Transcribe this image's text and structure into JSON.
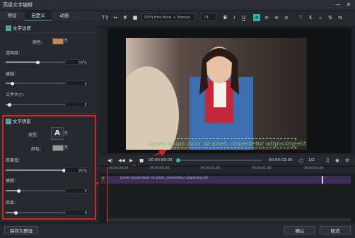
{
  "window": {
    "title": "高级文字编辑",
    "min_icon": "minimize-icon",
    "close_icon": "close-icon"
  },
  "tabs": [
    {
      "label": "预设"
    },
    {
      "label": "自定义"
    },
    {
      "label": "动画"
    }
  ],
  "text_border": {
    "title": "文字边框",
    "color_label": "颜色：",
    "color": "#c8894a",
    "opacity_label": "透明度：",
    "opacity_value": "50%",
    "opacity_level": 0.5,
    "blur_label": "模糊：",
    "blur_value": "2",
    "blur_level": 0.1,
    "size_label": "文件大小：",
    "size_value": "2",
    "size_level": 0.05
  },
  "text_shadow": {
    "title": "文字阴影",
    "type_label": "类型：",
    "type_glyph": "A",
    "color_label": "颜色：",
    "color": "#9a9a9a",
    "distance_label": "距离值：",
    "distance_value": "91%",
    "distance_level": 0.91,
    "blur_label": "模糊：",
    "blur_value": "4",
    "blur_level": 0.2,
    "size_label": "距离：",
    "size_value": "3",
    "size_level": 0.15
  },
  "toolbar": {
    "font_name": "DFPLiHei-Bold + Roman",
    "font_size": "74",
    "bold_label": "B",
    "italic_label": "I",
    "underline_label": "U"
  },
  "preview": {
    "caption": "Lorem ipsum dolor sit amet, consectetur adipiscing elit"
  },
  "playback": {
    "current_time": "00:00:00:00",
    "total_time": "00:00:02:00",
    "zoom_label": "1/2"
  },
  "ruler_labels": [
    "00:00:00:00",
    "00:00:00:10",
    "00:00:01:00",
    "00:00:01:10",
    "00:00:02:00"
  ],
  "track": {
    "text": "Lorem ipsum dolor sit amet, consectetur adipiscing elit"
  },
  "footer": {
    "save_preset": "保存为预设",
    "ok": "确认",
    "cancel": "取消"
  },
  "colors": {
    "accent": "#2fb8a8",
    "highlight_box": "#e02020",
    "caption_color": "#7fc86c"
  }
}
